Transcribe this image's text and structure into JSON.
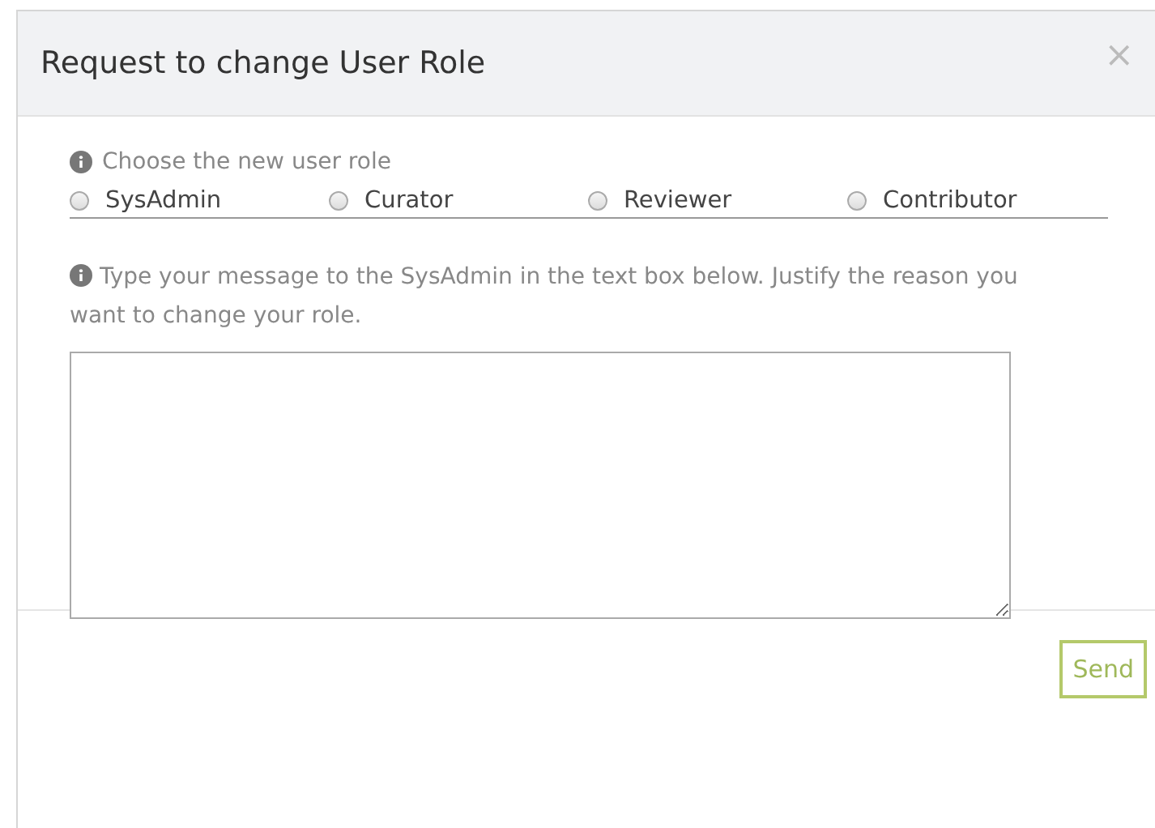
{
  "dialog": {
    "title": "Request to change User Role",
    "close": "×"
  },
  "role_prompt": "Choose the new user role",
  "roles": [
    {
      "label": "SysAdmin",
      "selected": false
    },
    {
      "label": "Curator",
      "selected": false
    },
    {
      "label": "Reviewer",
      "selected": false
    },
    {
      "label": "Contributor",
      "selected": false
    }
  ],
  "message_prompt": "Type your message to the SysAdmin in the text box below. Justify the reason you want to change your role.",
  "buttons": [
    "Send"
  ]
}
